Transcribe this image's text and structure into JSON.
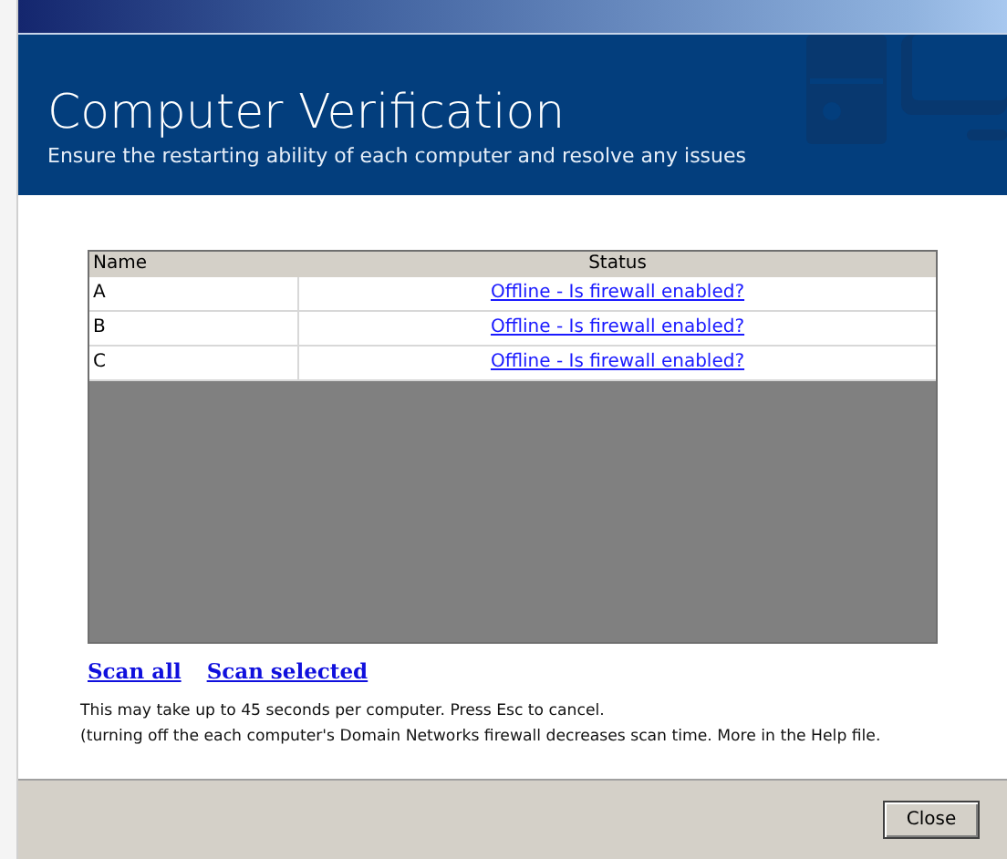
{
  "header": {
    "title": "Computer Verification",
    "subtitle": "Ensure the restarting ability of each computer and resolve any issues"
  },
  "table": {
    "columns": [
      "Name",
      "Status"
    ],
    "rows": [
      {
        "name": "A",
        "status": "Offline - Is firewall enabled?"
      },
      {
        "name": "B",
        "status": "Offline - Is firewall enabled?"
      },
      {
        "name": "C",
        "status": "Offline - Is firewall enabled?"
      }
    ]
  },
  "actions": [
    "Scan all",
    "Scan selected"
  ],
  "notes": [
    "This may take up to 45 seconds per computer. Press Esc to cancel.",
    "(turning off the each computer's Domain Networks firewall decreases scan time. More in the Help file."
  ],
  "buttons": [
    "Close"
  ]
}
